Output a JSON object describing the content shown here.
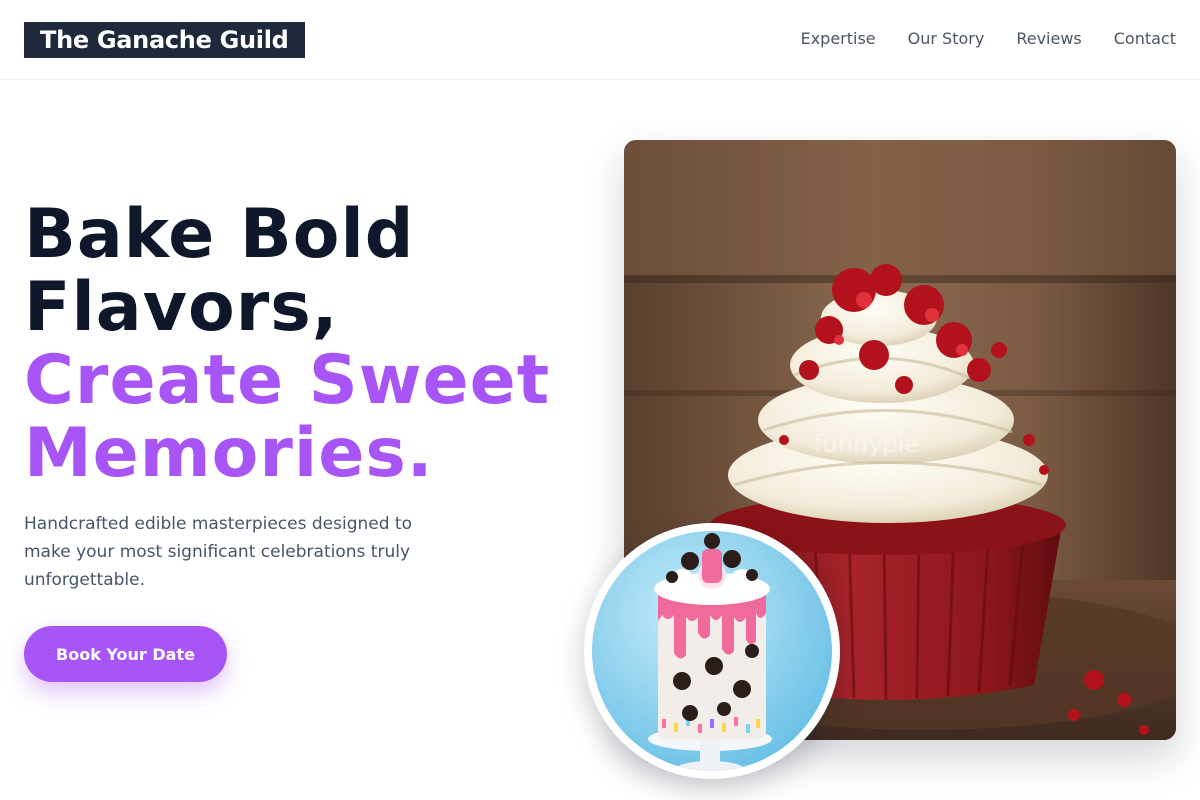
{
  "header": {
    "logo_text": "The Ganache Guild",
    "nav": [
      {
        "label": "Expertise"
      },
      {
        "label": "Our Story"
      },
      {
        "label": "Reviews"
      },
      {
        "label": "Contact"
      }
    ]
  },
  "hero": {
    "headline_line1": "Bake Bold",
    "headline_line2": "Flavors,",
    "headline_accent_line1": "Create Sweet",
    "headline_accent_line2": "Memories.",
    "subtext": "Handcrafted edible masterpieces designed to make your most significant celebrations truly unforgettable.",
    "cta_label": "Book Your Date",
    "main_image_watermark": "funnypie"
  },
  "colors": {
    "accent": "#a855f7",
    "dark": "#0f172a",
    "logo_bg": "#1e293b",
    "muted_text": "#475569"
  },
  "images": {
    "main": "red-velvet-cupcake-photo",
    "inset": "drip-cake-photo"
  }
}
